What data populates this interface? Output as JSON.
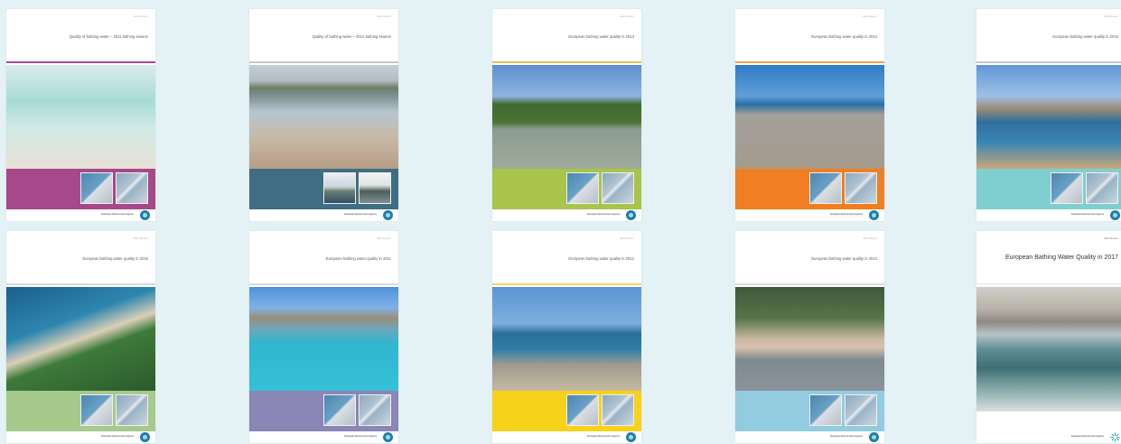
{
  "covers": [
    {
      "series": "EEA Report",
      "title": "Quality of bathing water – 2011 bathing season",
      "accent": "#b04a92",
      "band": "#a7488a",
      "agency": "European Environment Agency",
      "photo": "beach-aerial"
    },
    {
      "series": "EEA Report",
      "title": "Quality of bathing water – 2012 bathing season",
      "accent": "#c8c8c8",
      "band": "#3f6d84",
      "agency": "European Environment Agency",
      "photo": "lake-pier"
    },
    {
      "series": "EEA Report",
      "title": "European bathing water quality in 2013",
      "accent": "#e7c24b",
      "band": "#a8c44a",
      "agency": "European Environment Agency",
      "photo": "lake-island"
    },
    {
      "series": "EEA Report",
      "title": "European bathing water quality in 2014",
      "accent": "#f0a44a",
      "band": "#ef7f22",
      "agency": "European Environment Agency",
      "photo": "crowded-beach"
    },
    {
      "series": "EEA Report",
      "title": "European bathing water quality in 2015",
      "accent": "#c8c8c8",
      "band": "#7fcfd0",
      "agency": "European Environment Agency",
      "photo": "bay-coast"
    },
    {
      "series": "EEA Report",
      "title": "European bathing water quality in 2016",
      "accent": "#dadada",
      "band": "#a6c98c",
      "agency": "European Environment Agency",
      "photo": "spit-aerial"
    },
    {
      "series": "EEA Report",
      "title": "European bathing water quality in 2011",
      "accent": "#dadada",
      "band": "#8a86b6",
      "agency": "European Environment Agency",
      "photo": "lagoon"
    },
    {
      "series": "EEA Report",
      "title": "European bathing water quality in 2012",
      "accent": "#f5d75a",
      "band": "#f6d21b",
      "agency": "European Environment Agency",
      "photo": "palm-beach"
    },
    {
      "series": "EEA Report",
      "title": "European bathing water quality in 2013",
      "accent": "#dadada",
      "band": "#93cbe0",
      "agency": "European Environment Agency",
      "photo": "forest-lake"
    },
    {
      "series": "EEA Report",
      "title": "European Bathing Water Quality in 2017",
      "accent": "#ffffff",
      "band": "#ffffff",
      "agency": "European Environment Agency",
      "photo": "city-waves"
    }
  ]
}
